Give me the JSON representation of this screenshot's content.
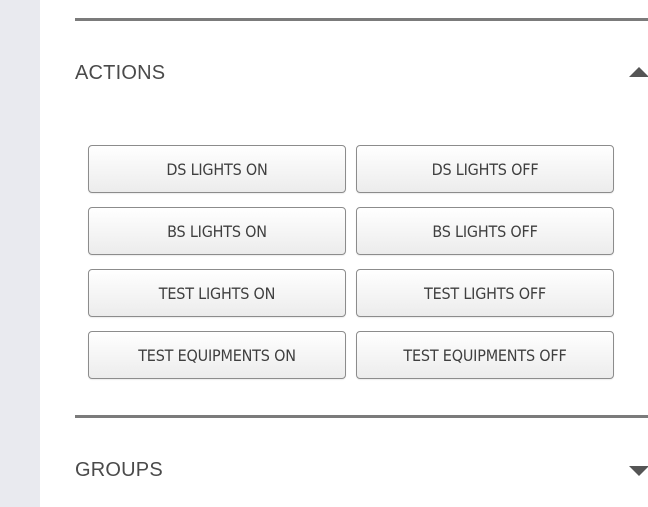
{
  "sections": {
    "actions": {
      "title": "ACTIONS",
      "expanded": true,
      "toggle_icon": "chevron-up-icon",
      "buttons": [
        "DS LIGHTS ON",
        "DS LIGHTS OFF",
        "BS LIGHTS ON",
        "BS LIGHTS OFF",
        "TEST LIGHTS ON",
        "TEST LIGHTS OFF",
        "TEST EQUIPMENTS ON",
        "TEST EQUIPMENTS OFF"
      ]
    },
    "groups": {
      "title": "GROUPS",
      "expanded": false,
      "toggle_icon": "chevron-down-icon"
    }
  },
  "colors": {
    "sidebar_strip": "#e9eaef",
    "divider": "#7b7b7b",
    "caret": "#555555",
    "text": "#4a4a4a",
    "button_border": "#8c8c8c"
  }
}
